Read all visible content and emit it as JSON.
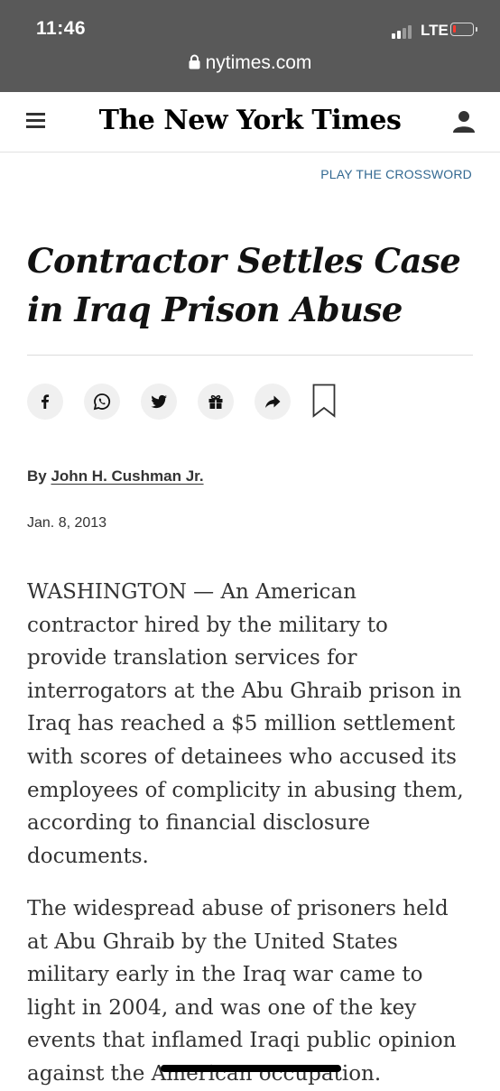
{
  "status_bar": {
    "time": "11:46",
    "carrier": "LTE",
    "battery_level_percent": 15,
    "battery_color": "#ff3b30"
  },
  "browser": {
    "url": "nytimes.com",
    "lock_icon": "lock-icon"
  },
  "header": {
    "menu_icon": "hamburger-menu-icon",
    "logo": "The New York Times",
    "account_icon": "user-icon"
  },
  "crossword_link": "PLAY THE CROSSWORD",
  "article": {
    "headline": "Contractor Settles Case in Iraq Prison Abuse",
    "share_buttons": [
      "facebook-icon",
      "whatsapp-icon",
      "twitter-icon",
      "gift-icon",
      "share-arrow-icon"
    ],
    "bookmark_icon": "bookmark-icon",
    "byline_prefix": "By",
    "author": "John H. Cushman Jr.",
    "date": "Jan. 8, 2013",
    "paragraphs": [
      "WASHINGTON — An American contractor hired by the military to provide translation services for interrogators at the Abu Ghraib prison in Iraq has reached a $5 million settlement with scores of detainees who accused its employees of complicity in abusing them, according to financial disclosure documents.",
      "The widespread abuse of prisoners held at Abu Ghraib by the United States military early in the Iraq war came to light in 2004, and was one of the key events that inflamed Iraqi public opinion against the American occupation."
    ],
    "paragraph_1_lines": [
      "WASHINGTON — An American",
      "contractor hired by the military to",
      "provide translation services for",
      "interrogators at the Abu Ghraib prison in",
      "Iraq has reached a $5 million settlement",
      "with scores of detainees who accused its",
      "employees of complicity in abusing them,",
      "according to financial disclosure",
      "documents."
    ],
    "paragraph_2_lines": [
      "The widespread abuse of prisoners held",
      "at Abu Ghraib by the United States",
      "military early in the Iraq war came to",
      "light in 2004, and was one of the key",
      "events that inflamed Iraqi public opinion",
      "against the American occupation."
    ]
  },
  "colors": {
    "status_bar_bg": "#595959",
    "link_blue": "#326891",
    "text": "#333333"
  }
}
